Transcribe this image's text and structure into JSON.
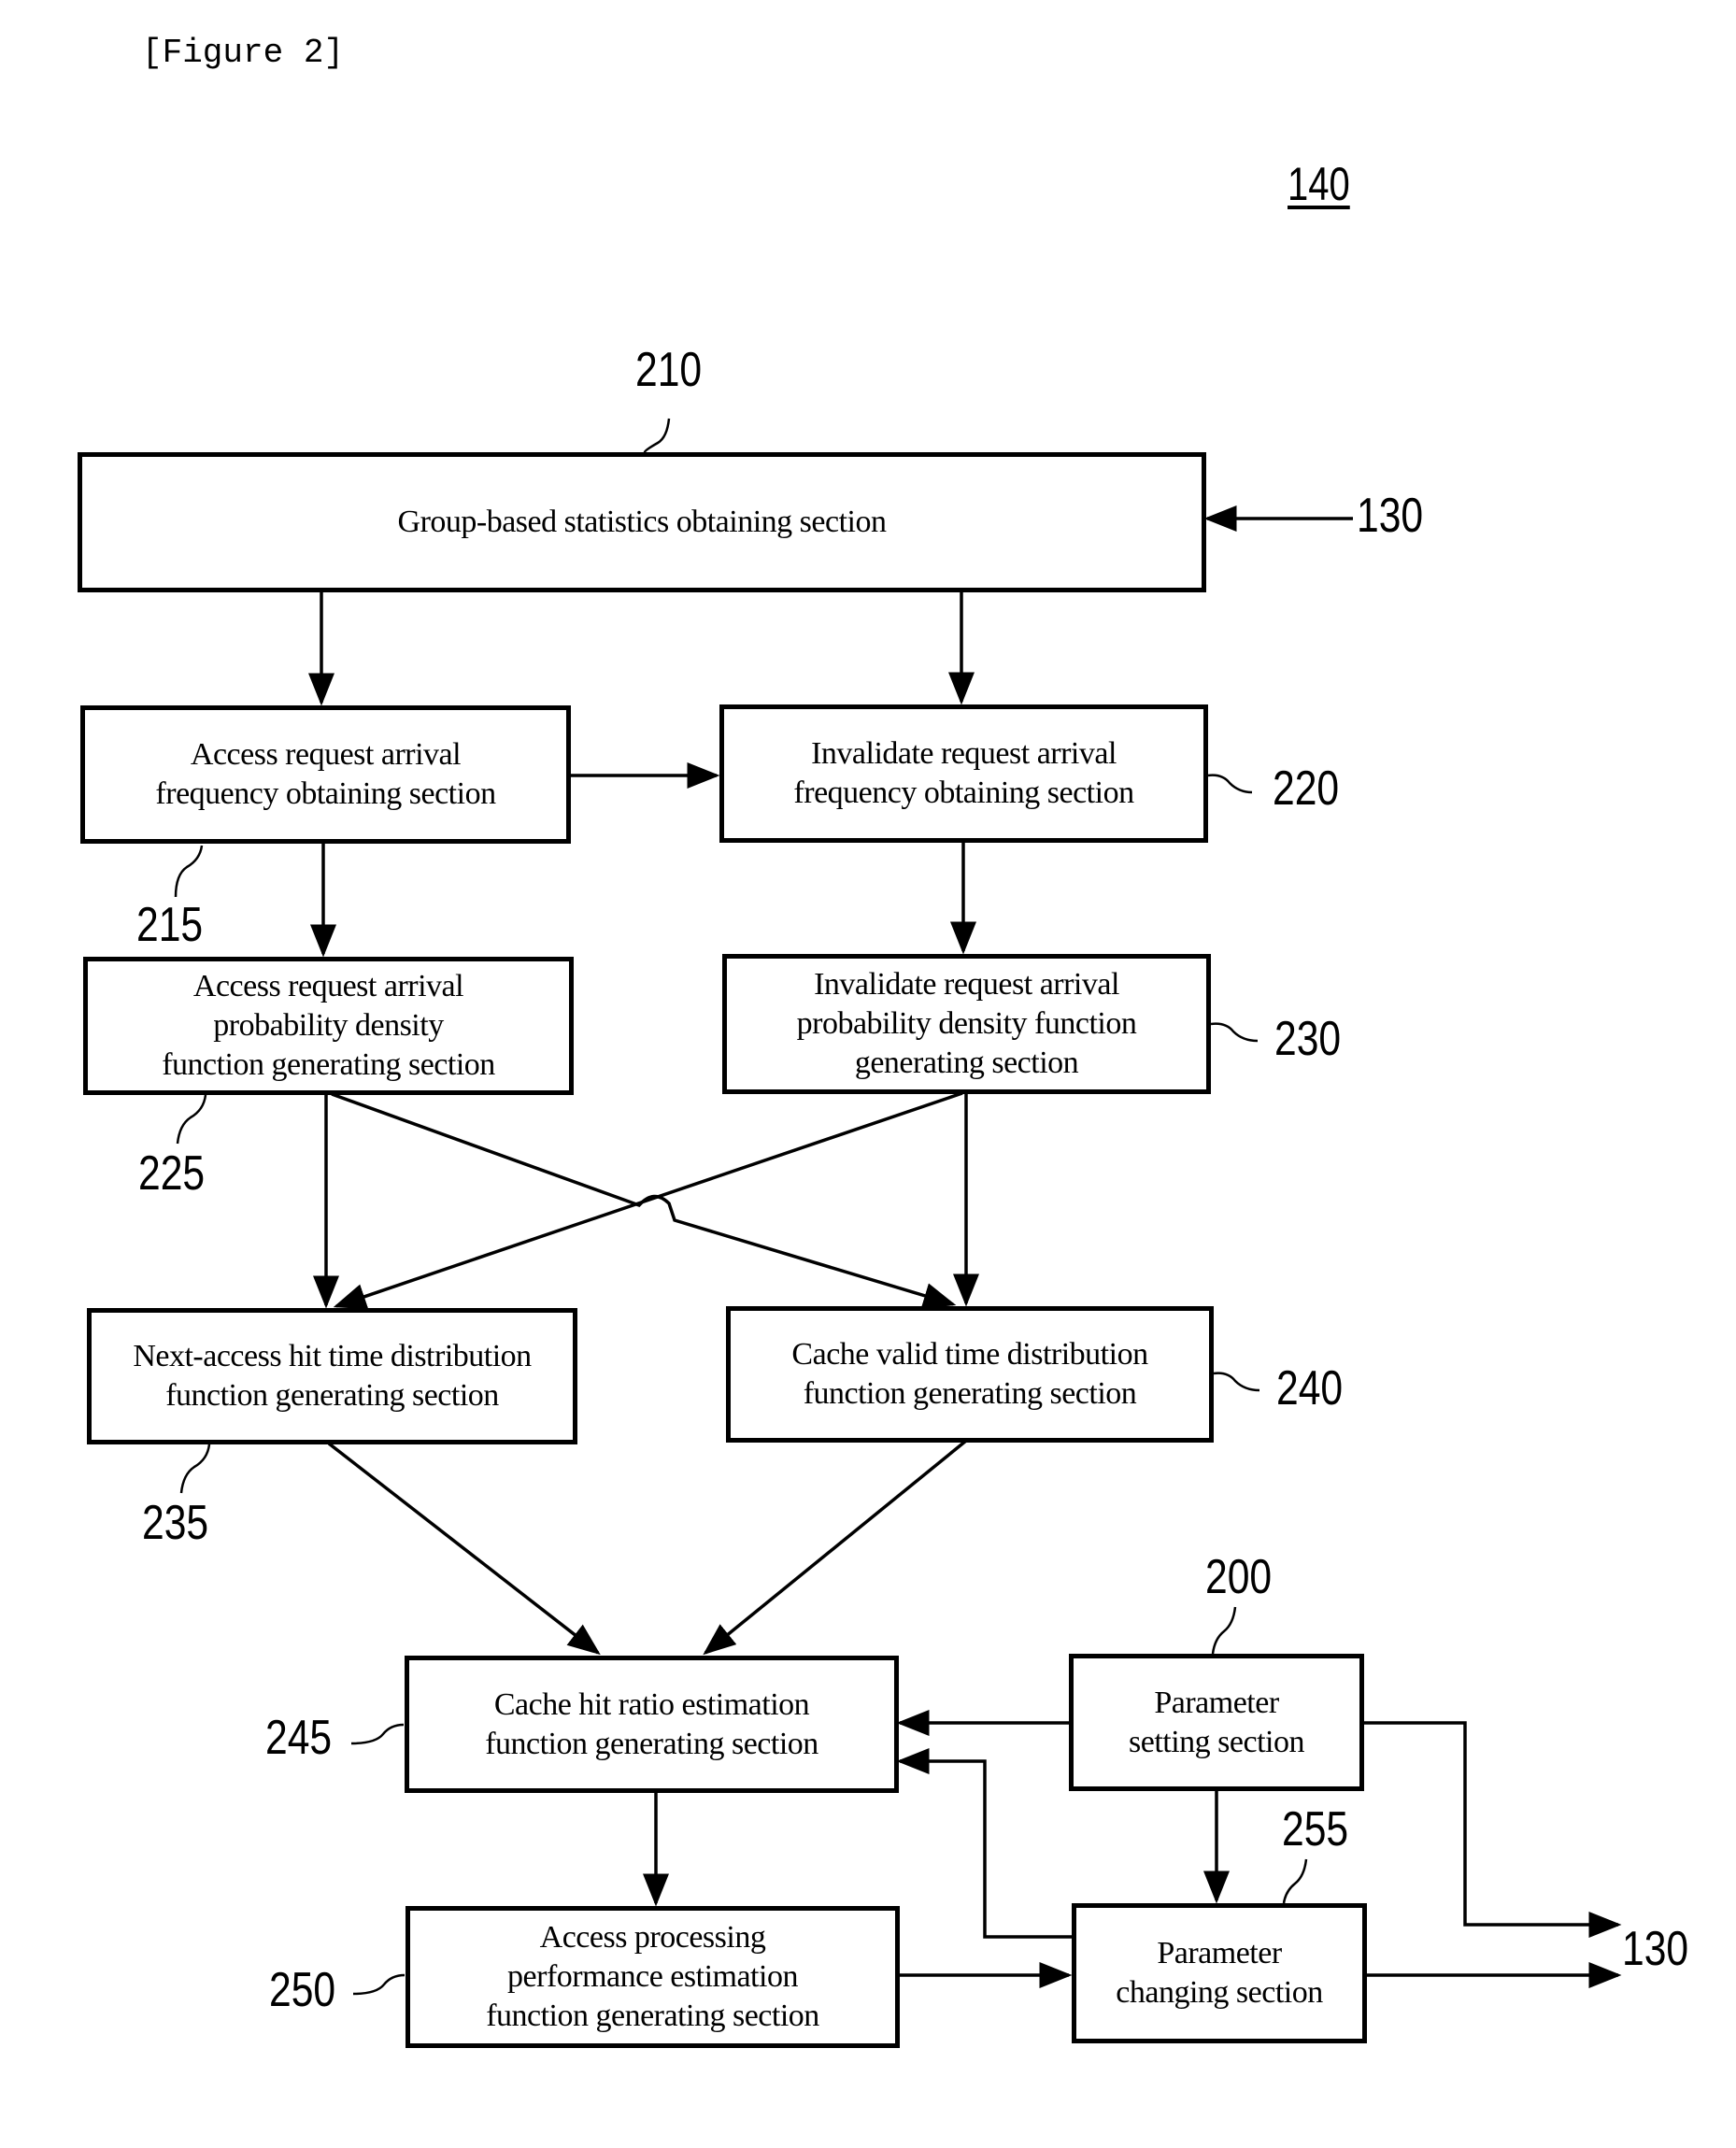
{
  "figure": {
    "caption": "[Figure 2]",
    "reference": "140"
  },
  "external_refs": {
    "input": "130",
    "output": "130"
  },
  "boxes": {
    "b210": {
      "ref": "210",
      "label": "Group-based statistics obtaining section"
    },
    "b215": {
      "ref": "215",
      "label": "Access request arrival\nfrequency obtaining section"
    },
    "b220": {
      "ref": "220",
      "label": "Invalidate request arrival\nfrequency obtaining section"
    },
    "b225": {
      "ref": "225",
      "label": "Access request arrival\nprobability density\nfunction generating section"
    },
    "b230": {
      "ref": "230",
      "label": "Invalidate request arrival\nprobability density function\ngenerating section"
    },
    "b235": {
      "ref": "235",
      "label": "Next-access hit time distribution\nfunction generating section"
    },
    "b240": {
      "ref": "240",
      "label": "Cache valid time distribution\nfunction generating section"
    },
    "b245": {
      "ref": "245",
      "label": "Cache hit ratio estimation\nfunction generating section"
    },
    "b200": {
      "ref": "200",
      "label": "Parameter\nsetting section"
    },
    "b250": {
      "ref": "250",
      "label": "Access processing\nperformance estimation\nfunction generating section"
    },
    "b255": {
      "ref": "255",
      "label": "Parameter\nchanging section"
    }
  },
  "connections": [
    {
      "from": "130",
      "to": "210"
    },
    {
      "from": "210",
      "to": "215"
    },
    {
      "from": "210",
      "to": "220"
    },
    {
      "from": "215",
      "to": "220"
    },
    {
      "from": "215",
      "to": "225"
    },
    {
      "from": "220",
      "to": "230"
    },
    {
      "from": "225",
      "to": "235"
    },
    {
      "from": "225",
      "to": "240"
    },
    {
      "from": "230",
      "to": "235"
    },
    {
      "from": "230",
      "to": "240"
    },
    {
      "from": "235",
      "to": "245"
    },
    {
      "from": "240",
      "to": "245"
    },
    {
      "from": "200",
      "to": "245"
    },
    {
      "from": "255",
      "to": "245"
    },
    {
      "from": "200",
      "to": "255"
    },
    {
      "from": "200",
      "to": "130"
    },
    {
      "from": "245",
      "to": "250"
    },
    {
      "from": "250",
      "to": "255"
    },
    {
      "from": "255",
      "to": "130"
    }
  ]
}
